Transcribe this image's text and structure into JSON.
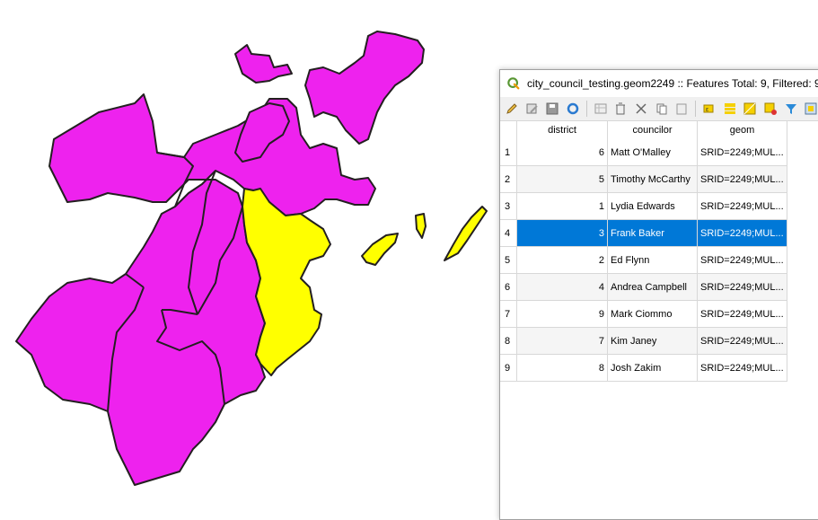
{
  "window": {
    "title": "city_council_testing.geom2249 :: Features Total: 9, Filtered: 9,"
  },
  "toolbar": {
    "icons": [
      "pencil-icon",
      "multi-edit-icon",
      "save-icon",
      "refresh-icon",
      "new-feature-icon",
      "delete-icon",
      "cut-icon",
      "copy-icon",
      "paste-icon",
      "expression-select-icon",
      "select-all-icon",
      "invert-selection-icon",
      "deselect-icon",
      "filter-icon",
      "pan-to-selection-icon"
    ]
  },
  "table": {
    "columns": [
      "district",
      "councilor",
      "geom"
    ],
    "rows": [
      {
        "n": "1",
        "district": "6",
        "councilor": "Matt O'Malley",
        "geom": "SRID=2249;MUL..."
      },
      {
        "n": "2",
        "district": "5",
        "councilor": "Timothy McCarthy",
        "geom": "SRID=2249;MUL..."
      },
      {
        "n": "3",
        "district": "1",
        "councilor": "Lydia Edwards",
        "geom": "SRID=2249;MUL..."
      },
      {
        "n": "4",
        "district": "3",
        "councilor": "Frank Baker",
        "geom": "SRID=2249;MUL..."
      },
      {
        "n": "5",
        "district": "2",
        "councilor": "Ed Flynn",
        "geom": "SRID=2249;MUL..."
      },
      {
        "n": "6",
        "district": "4",
        "councilor": "Andrea Campbell",
        "geom": "SRID=2249;MUL..."
      },
      {
        "n": "7",
        "district": "9",
        "councilor": "Mark Ciommo",
        "geom": "SRID=2249;MUL..."
      },
      {
        "n": "8",
        "district": "7",
        "councilor": "Kim Janey",
        "geom": "SRID=2249;MUL..."
      },
      {
        "n": "9",
        "district": "8",
        "councilor": "Josh Zakim",
        "geom": "SRID=2249;MUL..."
      }
    ],
    "selected_row": 4
  },
  "map": {
    "fill_default": "#ee22ee",
    "fill_selected": "#ffff00",
    "stroke": "#231f20",
    "selection_color": "#0078d7"
  }
}
